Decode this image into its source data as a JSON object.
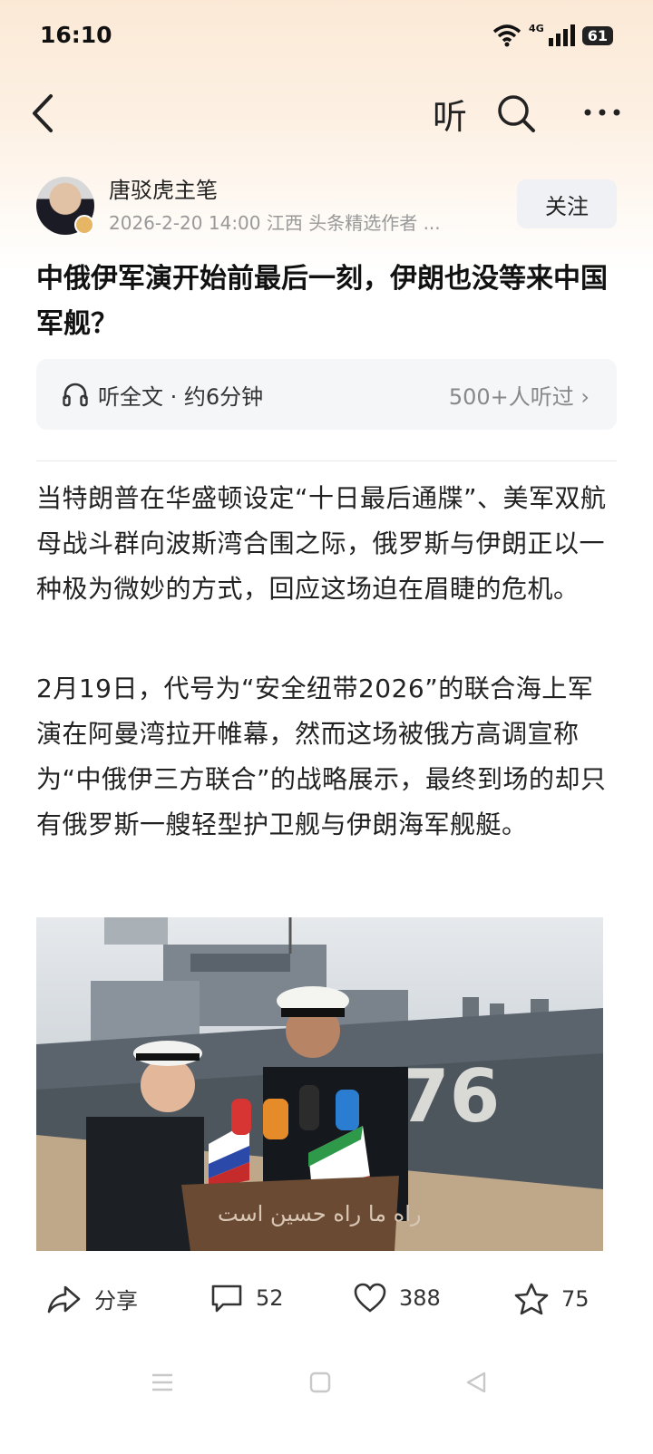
{
  "status": {
    "time": "16:10",
    "network": "4G",
    "battery": "61"
  },
  "nav": {
    "listen_label": "听"
  },
  "author": {
    "name": "唐驳虎主笔",
    "meta": "2026-2-20  14:00  江西  头条精选作者 ...",
    "follow_label": "关注"
  },
  "article": {
    "title": "中俄伊军演开始前最后一刻，伊朗也没等来中国军舰？",
    "listen_label": "听全文 · 约6分钟",
    "listen_count": "500+人听过 ›",
    "paragraph_1": "当特朗普在华盛顿设定“十日最后通牒”、美军双航母战斗群向波斯湾合围之际，俄罗斯与伊朗正以一种极为微妙的方式，回应这场迫在眉睫的危机。",
    "paragraph_2": "2月19日，代号为“安全纽带2026”的联合海上军演在阿曼湾拉开帷幕，然而这场被俄方高调宣称为“中俄伊三方联合”的战略展示，最终到场的却只有俄罗斯一艘轻型护卫舰与伊朗海军舰艇。",
    "photo": {
      "hull_number": "76",
      "podium_text": "راه ما راه حسین است"
    }
  },
  "actions": {
    "share_label": "分享",
    "comments": "52",
    "likes": "388",
    "favorites": "75"
  },
  "colors": {
    "accent": "#e7b665",
    "text": "#222222",
    "muted": "#999999"
  }
}
